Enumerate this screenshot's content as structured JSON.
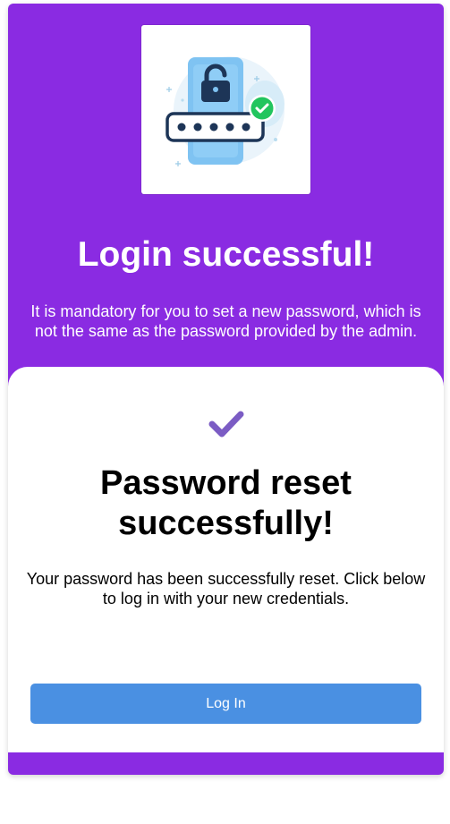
{
  "colors": {
    "background": "#8a2be2",
    "modal": "#ffffff",
    "accent_check": "#7b5cc4",
    "button": "#4a90e2",
    "button_text": "#ffffff"
  },
  "hero": {
    "image_icon": "password-lock-check-illustration"
  },
  "top": {
    "title": "Login successful!",
    "message": "It is mandatory for you to set a new password, which is not the same as the password provided by the admin."
  },
  "modal": {
    "icon": "checkmark-icon",
    "title": "Password reset successfully!",
    "message": "Your password has been successfully reset. Click below to log in with your new credentials.",
    "button_label": "Log In"
  }
}
